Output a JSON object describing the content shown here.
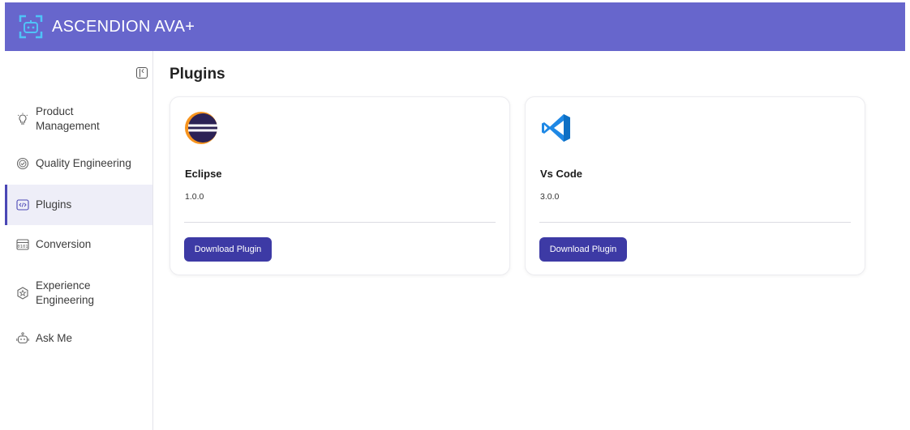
{
  "app": {
    "title": "ASCENDION AVA+",
    "logo_icon": "ava-robot-logo-icon",
    "header_color": "#6766cc"
  },
  "sidebar": {
    "collapse_icon": "sidebar-collapse-icon",
    "items": [
      {
        "label": "Product Management",
        "icon": "lightbulb-icon",
        "active": false
      },
      {
        "label": "Quality Engineering",
        "icon": "quality-badge-icon",
        "active": false
      },
      {
        "label": "Plugins",
        "icon": "code-brackets-icon",
        "active": true
      },
      {
        "label": "Conversion",
        "icon": "binary-icon",
        "active": false
      },
      {
        "label": "Experience Engineering",
        "icon": "star-hexagon-icon",
        "active": false
      },
      {
        "label": "Ask Me",
        "icon": "robot-icon",
        "active": false
      }
    ]
  },
  "main": {
    "title": "Plugins",
    "plugins": [
      {
        "name": "Eclipse",
        "version": "1.0.0",
        "icon": "eclipse-icon",
        "button_label": "Download Plugin"
      },
      {
        "name": "Vs Code",
        "version": "3.0.0",
        "icon": "vscode-icon",
        "button_label": "Download Plugin"
      }
    ]
  },
  "colors": {
    "accent": "#3d3aa5",
    "active_bg": "#eeeef8"
  }
}
